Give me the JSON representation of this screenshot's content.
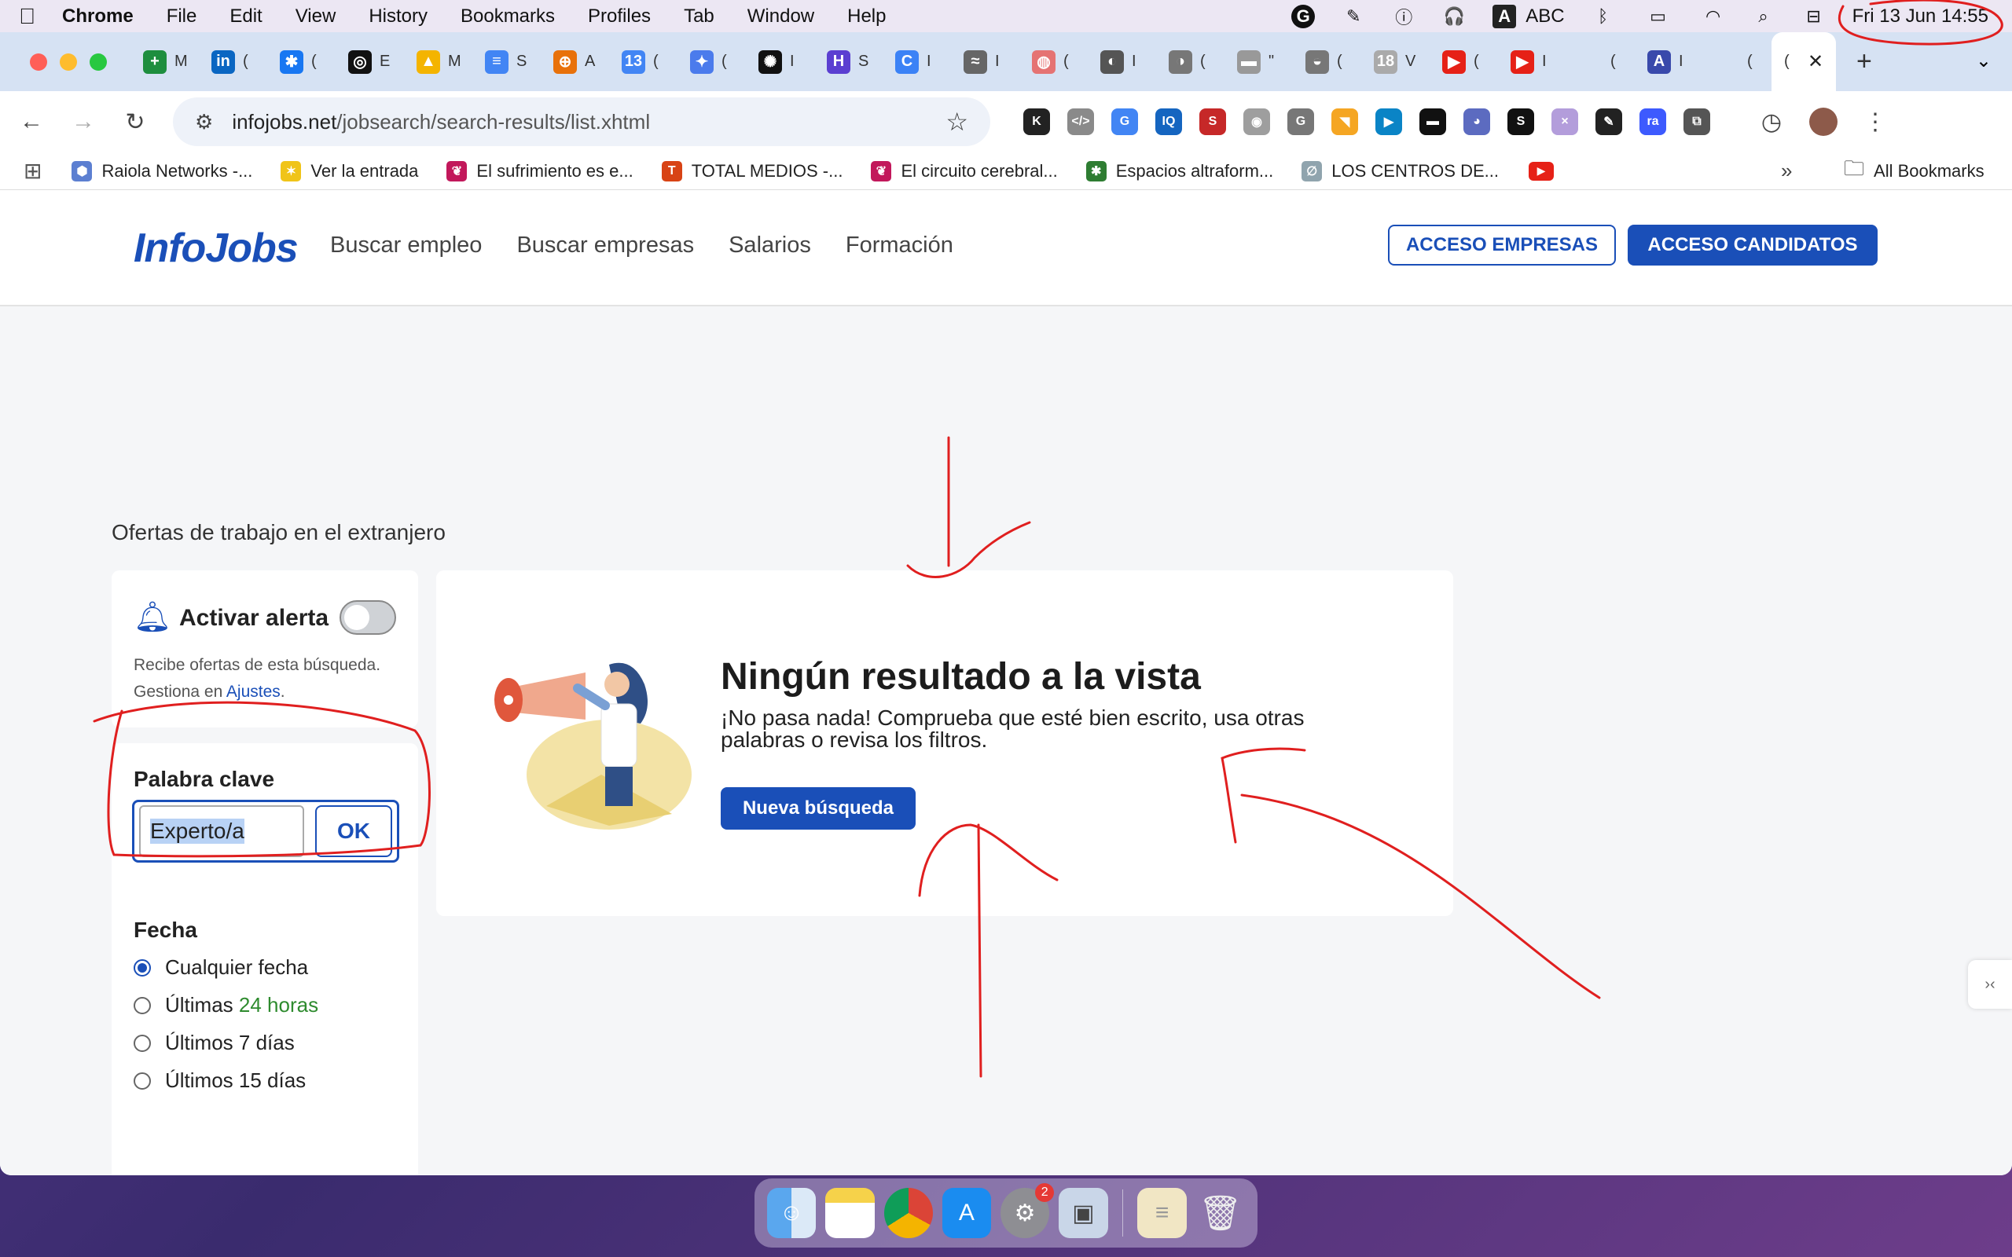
{
  "menubar": {
    "app": "Chrome",
    "items": [
      "File",
      "Edit",
      "View",
      "History",
      "Bookmarks",
      "Profiles",
      "Tab",
      "Window",
      "Help"
    ],
    "abc": "ABC",
    "clock": "Fri 13 Jun  14:55"
  },
  "tabs": [
    {
      "letter": "+",
      "color": "#1e8e3e",
      "title": "M"
    },
    {
      "letter": "in",
      "color": "#0a66c2",
      "title": "("
    },
    {
      "letter": "✱",
      "color": "#1877f2",
      "title": "("
    },
    {
      "letter": "◎",
      "color": "#111",
      "title": "E"
    },
    {
      "letter": "▲",
      "color": "#f4b400",
      "title": "M"
    },
    {
      "letter": "≡",
      "color": "#4285f4",
      "title": "S"
    },
    {
      "letter": "⊕",
      "color": "#e8710a",
      "title": "A"
    },
    {
      "letter": "13",
      "color": "#4285f4",
      "title": "("
    },
    {
      "letter": "✦",
      "color": "#4b7bec",
      "title": "("
    },
    {
      "letter": "✺",
      "color": "#111",
      "title": "I"
    },
    {
      "letter": "H",
      "color": "#5b3fd1",
      "title": "S"
    },
    {
      "letter": "C",
      "color": "#3b82f6",
      "title": "I"
    },
    {
      "letter": "≈",
      "color": "#666",
      "title": "I"
    },
    {
      "letter": "◍",
      "color": "#e57373",
      "title": "("
    },
    {
      "letter": "◐",
      "color": "#555",
      "title": "I"
    },
    {
      "letter": "◑",
      "color": "#777",
      "title": "("
    },
    {
      "letter": "▬",
      "color": "#999",
      "title": "\""
    },
    {
      "letter": "◒",
      "color": "#777",
      "title": "("
    },
    {
      "letter": "18",
      "color": "#aaa",
      "title": "V"
    },
    {
      "letter": "▶",
      "color": "#e62117",
      "title": "("
    },
    {
      "letter": "▶",
      "color": "#e62117",
      "title": "I"
    },
    {
      "letter": "",
      "color": "transparent",
      "title": "("
    },
    {
      "letter": "A",
      "color": "#3949ab",
      "title": "I"
    },
    {
      "letter": "",
      "color": "transparent",
      "title": "("
    }
  ],
  "active_tab": {
    "title": "("
  },
  "omnibox": {
    "host": "infojobs.net",
    "path": "/jobsearch/search-results/list.xhtml"
  },
  "extensions": [
    {
      "l": "K",
      "c": "#222"
    },
    {
      "l": "</>",
      "c": "#8a8a8a"
    },
    {
      "l": "G",
      "c": "#4285f4"
    },
    {
      "l": "IQ",
      "c": "#1565c0"
    },
    {
      "l": "S",
      "c": "#c62828"
    },
    {
      "l": "◉",
      "c": "#9e9e9e"
    },
    {
      "l": "G",
      "c": "#777"
    },
    {
      "l": "◥",
      "c": "#f5a623"
    },
    {
      "l": "▶",
      "c": "#0a84c6"
    },
    {
      "l": "▬",
      "c": "#111"
    },
    {
      "l": "◕",
      "c": "#5c6bc0"
    },
    {
      "l": "S",
      "c": "#111"
    },
    {
      "l": "×",
      "c": "#b39ddb"
    },
    {
      "l": "✎",
      "c": "#222"
    },
    {
      "l": "ra",
      "c": "#3d5afe"
    },
    {
      "l": "⧉",
      "c": "#555"
    }
  ],
  "bookmarks": [
    {
      "label": "Raiola Networks -...",
      "color": "#5c7fd1",
      "letter": "⬢"
    },
    {
      "label": "Ver la entrada",
      "color": "#f0c419",
      "letter": "✶"
    },
    {
      "label": "El sufrimiento es e...",
      "color": "#c2185b",
      "letter": "❦"
    },
    {
      "label": "TOTAL MEDIOS -...",
      "color": "#d84315",
      "letter": "T"
    },
    {
      "label": "El circuito cerebral...",
      "color": "#c2185b",
      "letter": "❦"
    },
    {
      "label": "Espacios altraform...",
      "color": "#2e7d32",
      "letter": "✱"
    },
    {
      "label": "LOS CENTROS DE...",
      "color": "#90a4ae",
      "letter": "∅"
    }
  ],
  "all_bookmarks": "All Bookmarks",
  "site": {
    "logo": "InfoJobs",
    "nav": [
      "Buscar empleo",
      "Buscar empresas",
      "Salarios",
      "Formación"
    ],
    "btn_empresas": "ACCESO EMPRESAS",
    "btn_candidatos": "ACCESO CANDIDATOS"
  },
  "page_title": "Ofertas de trabajo en el extranjero",
  "alert": {
    "title": "Activar alerta",
    "desc_1": "Recibe ofertas de esta búsqueda. Gestiona en ",
    "desc_link": "Ajustes",
    "desc_end": "."
  },
  "keyword": {
    "label": "Palabra clave",
    "value": "Experto/a",
    "ok": "OK"
  },
  "date_filter": {
    "label": "Fecha",
    "options": [
      {
        "text": "Cualquier fecha",
        "selected": true
      },
      {
        "pre": "Últimas ",
        "hl": "24 horas",
        "selected": false
      },
      {
        "text": "Últimos 7 días",
        "selected": false
      },
      {
        "text": "Últimos 15 días",
        "selected": false
      }
    ]
  },
  "result": {
    "title": "Ningún resultado a la vista",
    "subtitle": "¡No pasa nada! Comprueba que esté bien escrito, usa otras palabras o revisa los filtros.",
    "button": "Nueva búsqueda"
  },
  "dock_badge": "2",
  "colors": {
    "brand": "#1a4fb8",
    "annotation": "#e01f1f"
  }
}
